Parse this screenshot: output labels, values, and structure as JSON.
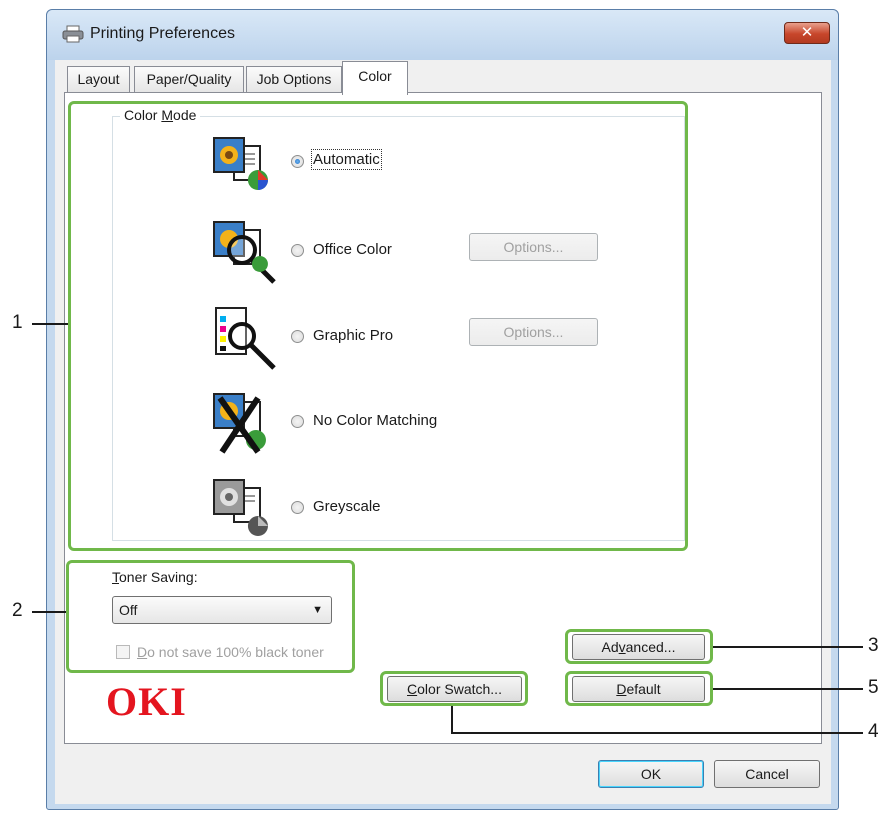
{
  "window": {
    "title": "Printing Preferences",
    "close_glyph": "✕"
  },
  "tabs": [
    {
      "label": "Layout"
    },
    {
      "label": "Paper/Quality"
    },
    {
      "label": "Job Options"
    },
    {
      "label": "Color"
    }
  ],
  "color_mode": {
    "legend_pre": "Color ",
    "legend_ul": "M",
    "legend_post": "ode",
    "options": [
      {
        "label": "Automatic",
        "selected": true,
        "icon": "automatic-color-icon"
      },
      {
        "label": "Office Color",
        "selected": false,
        "icon": "office-color-icon",
        "button": "Options..."
      },
      {
        "label": "Graphic Pro",
        "selected": false,
        "icon": "graphic-pro-icon",
        "button": "Options..."
      },
      {
        "label": "No Color Matching",
        "selected": false,
        "icon": "no-color-matching-icon"
      },
      {
        "label": "Greyscale",
        "selected": false,
        "icon": "greyscale-icon"
      }
    ]
  },
  "toner": {
    "label_ul": "T",
    "label_rest": "oner Saving:",
    "value": "Off",
    "checkbox_ul": "D",
    "checkbox_rest": "o not save 100% black toner"
  },
  "buttons": {
    "advanced_pre": "Ad",
    "advanced_ul": "v",
    "advanced_post": "anced...",
    "default_ul": "D",
    "default_post": "efault",
    "swatch_ul": "C",
    "swatch_post": "olor Swatch...",
    "ok": "OK",
    "cancel": "Cancel"
  },
  "logo": "OKI",
  "callouts": [
    "1",
    "2",
    "3",
    "4",
    "5"
  ],
  "colors": {
    "callout_green": "#70b84a",
    "logo_red": "#e4151f"
  }
}
